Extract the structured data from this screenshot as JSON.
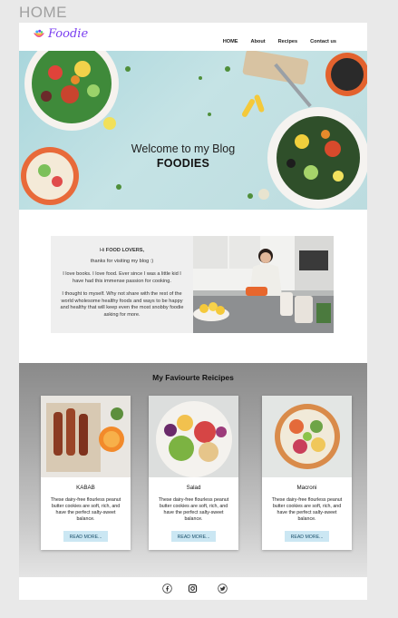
{
  "page_label": "HOME",
  "nav": {
    "brand": "Foodie",
    "links": [
      "HOME",
      "About",
      "Recipes",
      "Contact us"
    ]
  },
  "hero": {
    "title": "Welcome to my Blog",
    "subtitle": "FOODIES"
  },
  "intro": {
    "greeting_prefix": "Hi ",
    "greeting_bold": "FOOD LOVERS,",
    "thanks": "thanks for visiting my blog :)",
    "para1": "I love books. I love food. Ever since I was a little kid I have had this immense passion for cooking.",
    "para2": "I thought to myself. Why not share with the rest of the world wholesome healthy foods and ways to be happy and healthy that will keep even the most snobby foodie asking for more."
  },
  "recipes": {
    "title": "My Faviourte Reicipes",
    "cards": [
      {
        "name": "KABAB",
        "desc": "These dairy-free flourless peanut butter cookies are soft, rich, and have the perfect salty-sweet balance.",
        "button": "READ MORE..."
      },
      {
        "name": "Salad",
        "desc": "These dairy-free flourless peanut butter cookies are soft, rich, and have the perfect salty-sweet balance.",
        "button": "READ MORE..."
      },
      {
        "name": "Macroni",
        "desc": "These dairy-free flourless peanut butter cookies are soft, rich, and have the perfect salty-sweet balance.",
        "button": "READ MORE..."
      }
    ]
  },
  "social": [
    "facebook-icon",
    "instagram-icon",
    "twitter-icon"
  ],
  "colors": {
    "brand": "#7a3ef0",
    "button_bg": "#cbe7f3",
    "hero_bg": "#a9d6dc"
  }
}
